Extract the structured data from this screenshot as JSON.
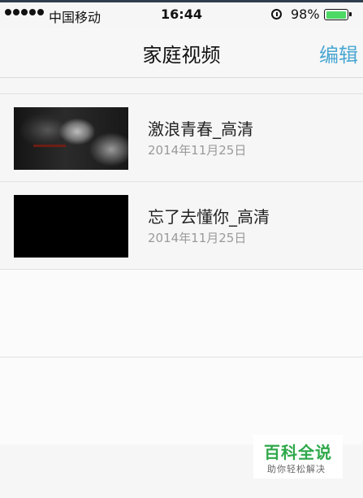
{
  "status_bar": {
    "carrier": "中国移动",
    "time": "16:44",
    "battery_percent": "98%",
    "battery_level": 0.98
  },
  "nav": {
    "title": "家庭视频",
    "edit_label": "编辑"
  },
  "videos": [
    {
      "title": "激浪青春_高清",
      "date": "2014年11月25日"
    },
    {
      "title": "忘了去懂你_高清",
      "date": "2014年11月25日"
    }
  ],
  "watermark": {
    "title": "百科全说",
    "subtitle": "助你轻松解决"
  },
  "colors": {
    "accent": "#4aa7d2",
    "battery": "#4cd964",
    "watermark": "#2ea84a"
  }
}
